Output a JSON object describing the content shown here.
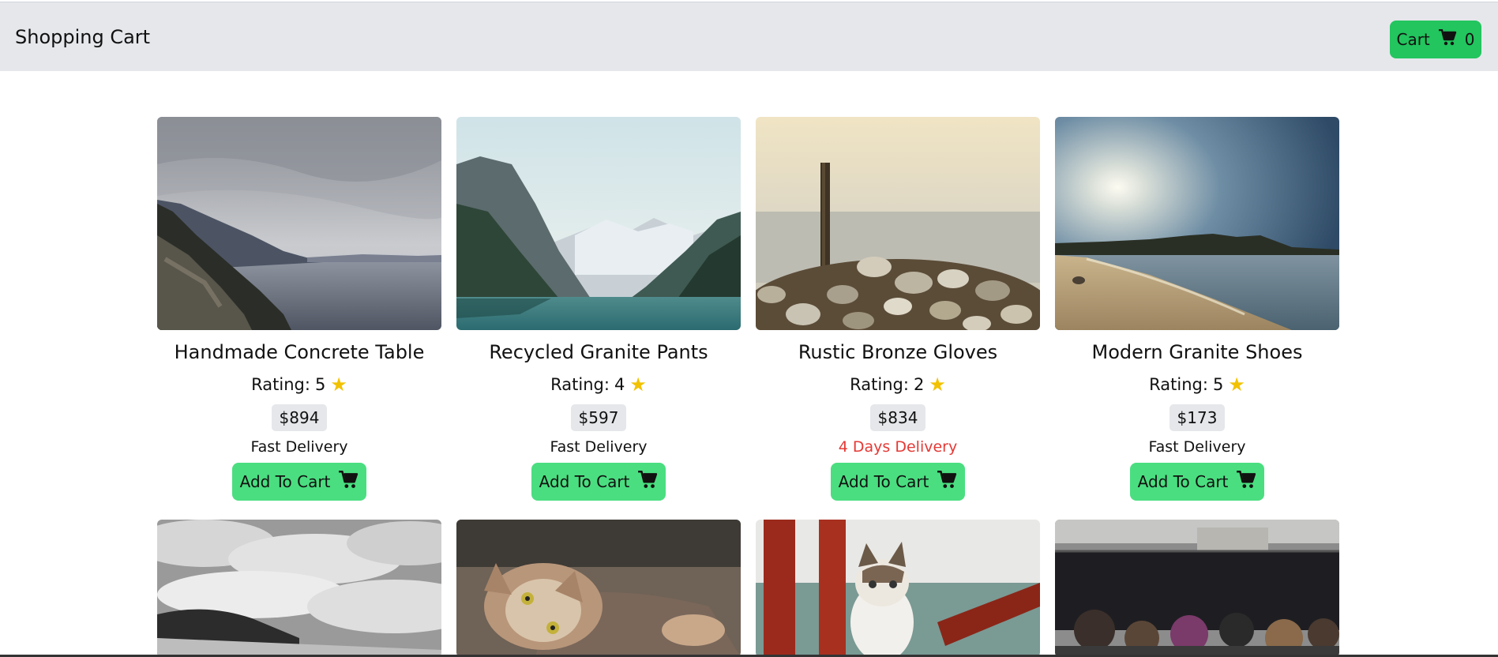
{
  "header": {
    "title": "Shopping Cart",
    "cart_label": "Cart",
    "cart_count": "0",
    "cart_icon": "cart-icon"
  },
  "colors": {
    "accent": "#22c55e",
    "button": "#4ade80",
    "star": "#f2c200",
    "slow_delivery": "#e53935",
    "header_bg": "#e5e7eb"
  },
  "products": [
    {
      "name": "Handmade Concrete Table",
      "rating_label": "Rating:",
      "rating": "5",
      "price": "$894",
      "delivery": "Fast Delivery",
      "add_label": "Add To Cart"
    },
    {
      "name": "Recycled Granite Pants",
      "rating_label": "Rating:",
      "rating": "4",
      "price": "$597",
      "delivery": "Fast Delivery",
      "add_label": "Add To Cart"
    },
    {
      "name": "Rustic Bronze Gloves",
      "rating_label": "Rating:",
      "rating": "2",
      "price": "$834",
      "delivery": "4 Days Delivery",
      "add_label": "Add To Cart"
    },
    {
      "name": "Modern Granite Shoes",
      "rating_label": "Rating:",
      "rating": "5",
      "price": "$173",
      "delivery": "Fast Delivery",
      "add_label": "Add To Cart"
    }
  ]
}
